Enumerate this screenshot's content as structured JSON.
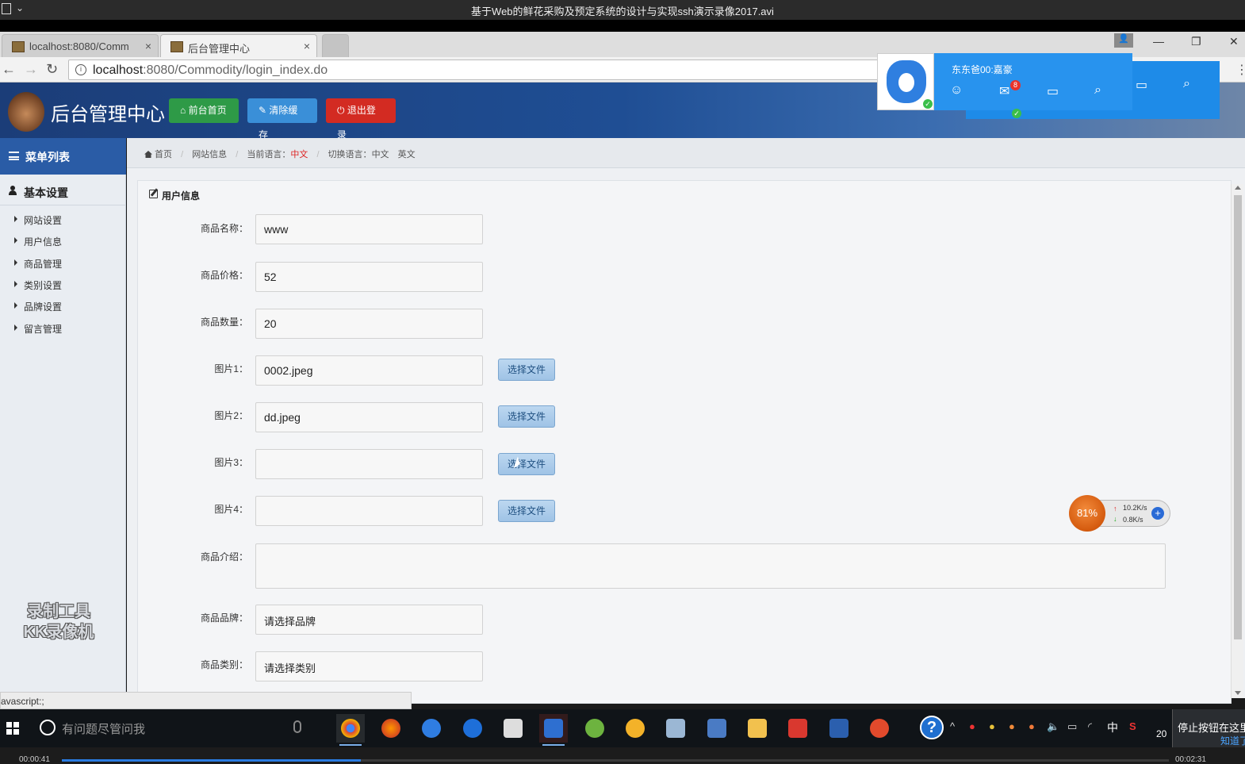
{
  "player": {
    "title": "基于Web的鲜花采购及预定系统的设计与实现ssh演示录像2017.avi",
    "elapsed": "00:00:41",
    "total": "00:02:31",
    "progress": 0.27
  },
  "browser": {
    "tabs": [
      {
        "label": "localhost:8080/Comm",
        "active": false
      },
      {
        "label": "后台管理中心",
        "active": true
      }
    ],
    "url_host": "localhost",
    "url_rest": ":8080/Commodity/login_index.do"
  },
  "header": {
    "title": "后台管理中心",
    "buttons": {
      "home": "前台首页",
      "clear_cache": "清除缓存",
      "logout": "退出登录"
    }
  },
  "sidebar": {
    "menu_title": "菜单列表",
    "group": "基本设置",
    "items": [
      "网站设置",
      "用户信息",
      "商品管理",
      "类别设置",
      "品牌设置",
      "留言管理"
    ],
    "watermark_line1": "录制工具",
    "watermark_line2": "KK录像机"
  },
  "breadcrumb": {
    "home": "首页",
    "site_info": "网站信息",
    "current_lang_label": "当前语言：",
    "current_lang": "中文",
    "switch_lang_label": "切换语言：",
    "lang_zh": "中文",
    "lang_en": "英文"
  },
  "form": {
    "panel_title": "用户信息",
    "name_label": "商品名称：",
    "name_value": "www",
    "price_label": "商品价格：",
    "price_value": "52",
    "qty_label": "商品数量：",
    "qty_value": "20",
    "pic1_label": "图片1：",
    "pic1_value": "0002.jpeg",
    "pic2_label": "图片2：",
    "pic2_value": "dd.jpeg",
    "pic3_label": "图片3：",
    "pic3_value": "",
    "pic4_label": "图片4：",
    "pic4_value": "",
    "choose_file": "选择文件",
    "intro_label": "商品介绍：",
    "brand_label": "商品品牌：",
    "brand_value": "请选择品牌",
    "category_label": "商品类别：",
    "category_value": "请选择类别"
  },
  "status_bar": "avascript:;",
  "popup": {
    "name": "东东爸00:嘉豪",
    "mail_count": "8"
  },
  "speed_widget": {
    "percent": "81%",
    "up": "10.2K/s",
    "down": "0.8K/s"
  },
  "taskbar": {
    "search_placeholder": "有问题尽管问我",
    "ime": "中",
    "clock": "20",
    "hint": "停止按钮在这里",
    "hint_link": "知道了"
  },
  "colors": {
    "header_blue": "#1f4e94",
    "sidebar_head": "#2a5ca6",
    "btn_green": "#2e9a47",
    "btn_blue": "#3a8fd8",
    "btn_red": "#d32b22"
  }
}
